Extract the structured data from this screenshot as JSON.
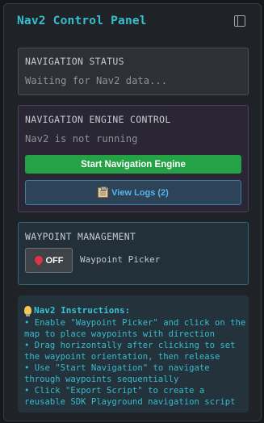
{
  "header": {
    "title": "Nav2 Control Panel",
    "toggle_icon": "sidebar-toggle-icon"
  },
  "status_card": {
    "label": "NAVIGATION STATUS",
    "status": "Waiting for Nav2 data..."
  },
  "engine_card": {
    "label": "NAVIGATION ENGINE CONTROL",
    "status": "Nav2 is not running",
    "start_button": "Start Navigation Engine",
    "logs_button": "View Logs (2)",
    "logs_icon": "clipboard-icon"
  },
  "waypoint_card": {
    "label": "WAYPOINT MANAGEMENT",
    "toggle_label": "OFF",
    "toggle_icon": "pushpin-icon",
    "picker_label": "Waypoint Picker"
  },
  "instructions": {
    "title": "Nav2 Instructions:",
    "icon": "lightbulb-icon",
    "items": [
      "• Enable \"Waypoint Picker\" and click on the map to place waypoints with direction",
      "• Drag horizontally after clicking to set the waypoint orientation, then release",
      "• Use \"Start Navigation\" to navigate through waypoints sequentially",
      "• Click \"Export Script\" to create a reusable SDK Playground navigation script"
    ]
  },
  "colors": {
    "accent": "#36c0cf",
    "start_button": "#23a345",
    "logs_button_text": "#5bb2ec"
  }
}
